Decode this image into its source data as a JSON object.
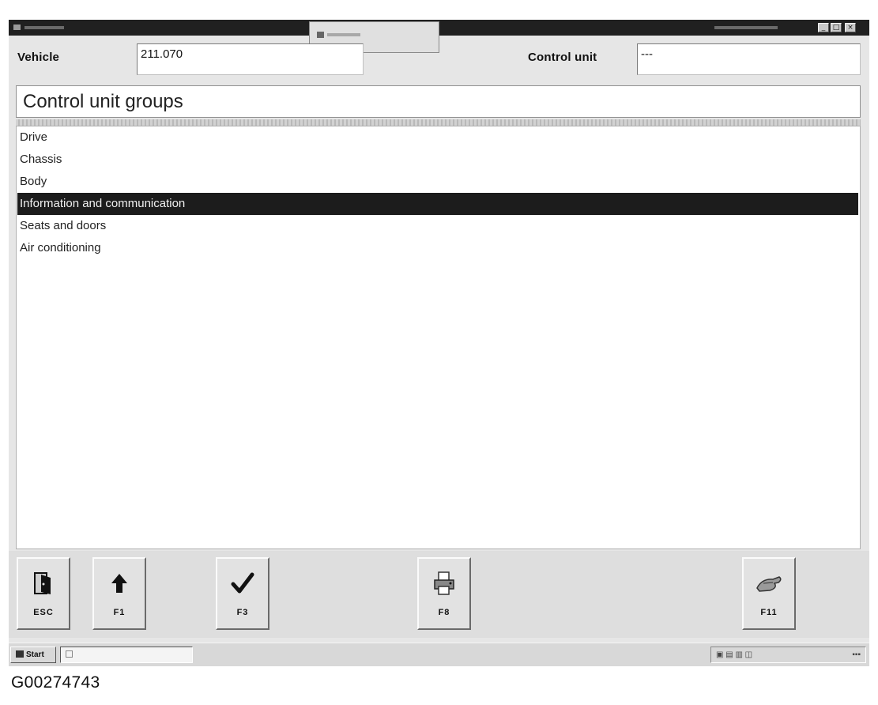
{
  "header": {
    "vehicle_label": "Vehicle",
    "vehicle_value": "211.070",
    "control_unit_label": "Control unit",
    "control_unit_value": "---"
  },
  "groups_title": "Control unit groups",
  "list": {
    "items": [
      {
        "label": "Drive",
        "selected": false
      },
      {
        "label": "Chassis",
        "selected": false
      },
      {
        "label": "Body",
        "selected": false
      },
      {
        "label": "Information and communication",
        "selected": true
      },
      {
        "label": "Seats and doors",
        "selected": false
      },
      {
        "label": "Air conditioning",
        "selected": false
      }
    ]
  },
  "toolbar": {
    "buttons": [
      {
        "key": "ESC",
        "icon": "door-exit-icon"
      },
      {
        "key": "F1",
        "icon": "arrow-up-icon"
      },
      {
        "key": "F3",
        "icon": "checkmark-icon"
      },
      {
        "key": "F8",
        "icon": "printer-icon"
      },
      {
        "key": "F11",
        "icon": "hand-help-icon"
      }
    ]
  },
  "taskbar": {
    "start_label": "Start"
  },
  "caption": "G00274743"
}
